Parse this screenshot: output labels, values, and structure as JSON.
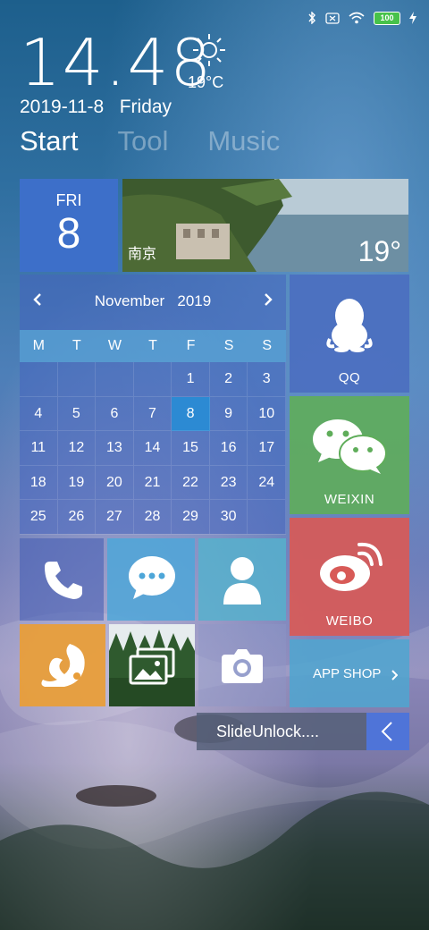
{
  "status": {
    "battery": "100"
  },
  "clock": {
    "time": "14.48",
    "date": "2019-11-8",
    "weekday": "Friday"
  },
  "weather": {
    "temp": "19°C"
  },
  "tabs": [
    "Start",
    "Tool",
    "Music"
  ],
  "date_tile": {
    "day_abbr": "FRI",
    "day_num": "8"
  },
  "photo_tile": {
    "city": "南京",
    "temp": "19°"
  },
  "calendar": {
    "month": "November",
    "year": "2019",
    "weekdays": [
      "M",
      "T",
      "W",
      "T",
      "F",
      "S",
      "S"
    ],
    "days": [
      "",
      "",
      "",
      "",
      "1",
      "2",
      "3",
      "4",
      "5",
      "6",
      "7",
      "8",
      "9",
      "10",
      "11",
      "12",
      "13",
      "14",
      "15",
      "16",
      "17",
      "18",
      "19",
      "20",
      "21",
      "22",
      "23",
      "24",
      "25",
      "26",
      "27",
      "28",
      "29",
      "30",
      ""
    ],
    "today": "8"
  },
  "tiles": {
    "qq": "QQ",
    "weixin": "WEIXIN",
    "weibo": "WEIBO",
    "app_shop": "APP SHOP"
  },
  "unlock": {
    "label": "SlideUnlock...."
  },
  "colors": {
    "date_tile": "#3d6fc9",
    "qq_tile": "#4a6cc0",
    "weixin_tile": "#5fad5a",
    "weibo_tile": "#d85a57",
    "uc_tile": "#e89e3a",
    "messages_tile": "#4da6d8",
    "contacts_tile": "#56b0cc",
    "app_shop_tile": "#4fa6d0",
    "unlock_arrow": "#4f74d8"
  }
}
